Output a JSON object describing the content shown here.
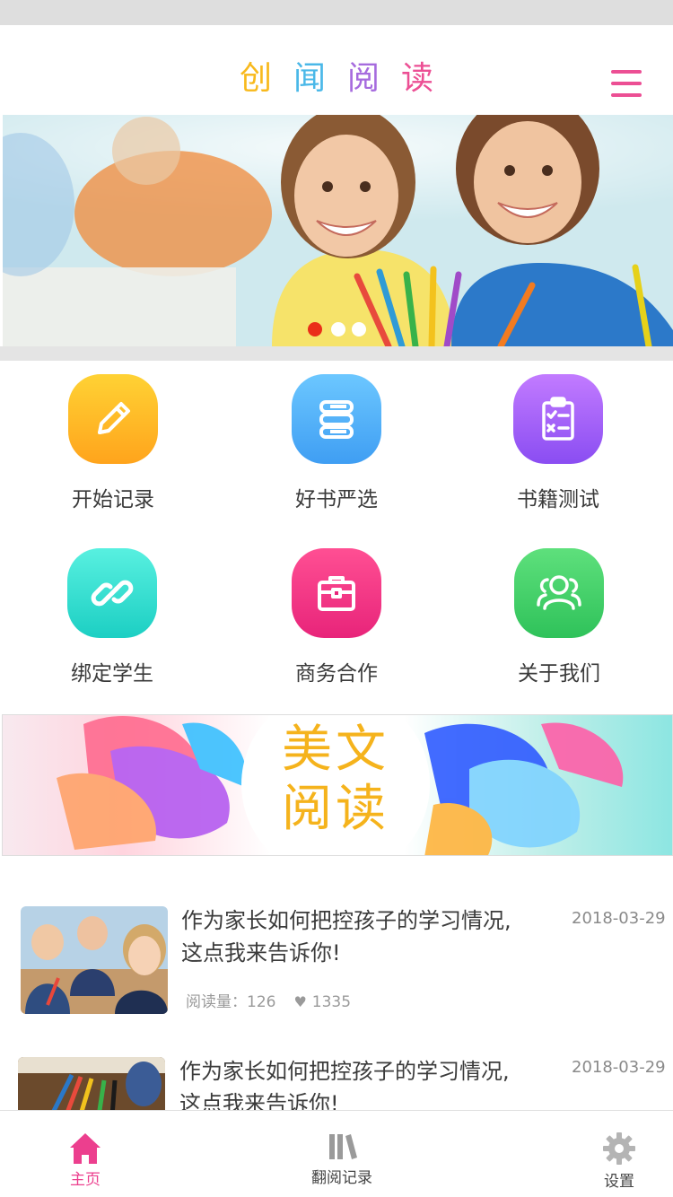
{
  "header": {
    "title_chars": [
      "创",
      "闻",
      "阅",
      "读"
    ],
    "title_colors": [
      "#f8b91c",
      "#4ab8e8",
      "#a66bde",
      "#ec4f94"
    ],
    "menu_icon": "hamburger-menu-icon"
  },
  "hero": {
    "carousel_index": 1,
    "carousel_count": 3
  },
  "features": [
    {
      "label": "开始记录",
      "icon": "pencil-icon",
      "color_top": "#ffd234",
      "color_bottom": "#ffa41c"
    },
    {
      "label": "好书严选",
      "icon": "books-icon",
      "color_top": "#6cc7ff",
      "color_bottom": "#3f9ef3"
    },
    {
      "label": "书籍测试",
      "icon": "clipboard-checklist-icon",
      "color_top": "#c27bff",
      "color_bottom": "#8a4df2"
    },
    {
      "label": "绑定学生",
      "icon": "link-icon",
      "color_top": "#58f0e0",
      "color_bottom": "#1ccfc3"
    },
    {
      "label": "商务合作",
      "icon": "briefcase-icon",
      "color_top": "#ff4f93",
      "color_bottom": "#e8247a"
    },
    {
      "label": "关于我们",
      "icon": "users-icon",
      "color_top": "#5ee07c",
      "color_bottom": "#2fc25a"
    }
  ],
  "article_banner": {
    "line1": "美文",
    "line2": "阅读"
  },
  "news": [
    {
      "title_line1": "作为家长如何把控孩子的学习情况,",
      "title_line2": "这点我来告诉你!",
      "date": "2018-03-29",
      "views_label": "阅读量：126",
      "likes": "1335"
    },
    {
      "title_line1": "作为家长如何把控孩子的学习情况,",
      "title_line2": "这点我来告诉你!",
      "date": "2018-03-29"
    }
  ],
  "tabs": [
    {
      "label": "主页",
      "icon": "home-icon",
      "active": true
    },
    {
      "label": "翻阅记录",
      "icon": "library-books-icon",
      "active": false
    },
    {
      "label": "设置",
      "icon": "gear-icon",
      "active": false
    }
  ],
  "colors": {
    "accent": "#ec3f8e",
    "carousel_active": "#ea2e19"
  }
}
